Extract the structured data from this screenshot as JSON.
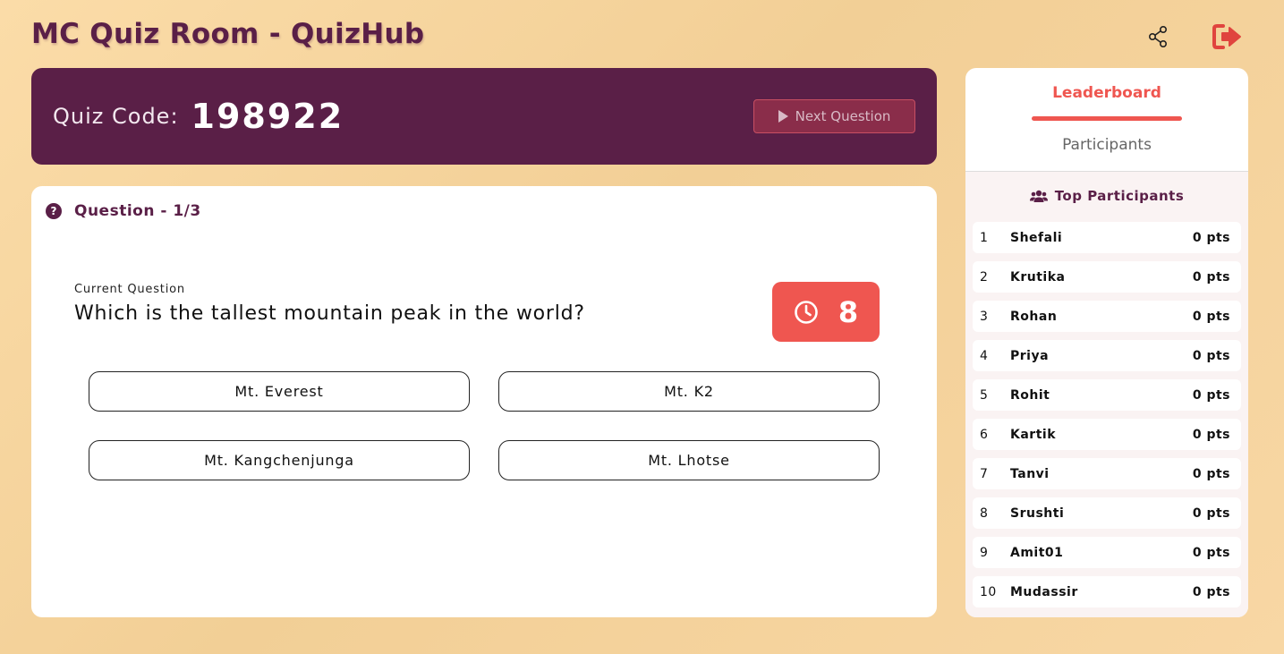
{
  "header": {
    "title": "MC Quiz Room - QuizHub",
    "share_icon": "share-icon",
    "logout_icon": "logout-icon"
  },
  "banner": {
    "code_label": "Quiz Code:",
    "code_value": "198922",
    "next_label": "Next Question"
  },
  "question": {
    "header": "Question - 1/3",
    "current_label": "Current Question",
    "text": "Which is the tallest mountain peak in the world?",
    "timer": "8",
    "options": [
      "Mt. Everest",
      "Mt. K2",
      "Mt. Kangchenjunga",
      "Mt. Lhotse"
    ]
  },
  "sidebar": {
    "tabs": [
      "Leaderboard",
      "Participants"
    ],
    "heading": "Top Participants",
    "leaderboard": [
      {
        "rank": "1",
        "name": "Shefali",
        "points": "0 pts"
      },
      {
        "rank": "2",
        "name": "Krutika",
        "points": "0 pts"
      },
      {
        "rank": "3",
        "name": "Rohan",
        "points": "0 pts"
      },
      {
        "rank": "4",
        "name": "Priya",
        "points": "0 pts"
      },
      {
        "rank": "5",
        "name": "Rohit",
        "points": "0 pts"
      },
      {
        "rank": "6",
        "name": "Kartik",
        "points": "0 pts"
      },
      {
        "rank": "7",
        "name": "Tanvi",
        "points": "0 pts"
      },
      {
        "rank": "8",
        "name": "Srushti",
        "points": "0 pts"
      },
      {
        "rank": "9",
        "name": "Amit01",
        "points": "0 pts"
      },
      {
        "rank": "10",
        "name": "Mudassir",
        "points": "0 pts"
      }
    ]
  },
  "colors": {
    "primary": "#5a1f47",
    "accent": "#ef5650",
    "background": "#f6d6a0"
  }
}
